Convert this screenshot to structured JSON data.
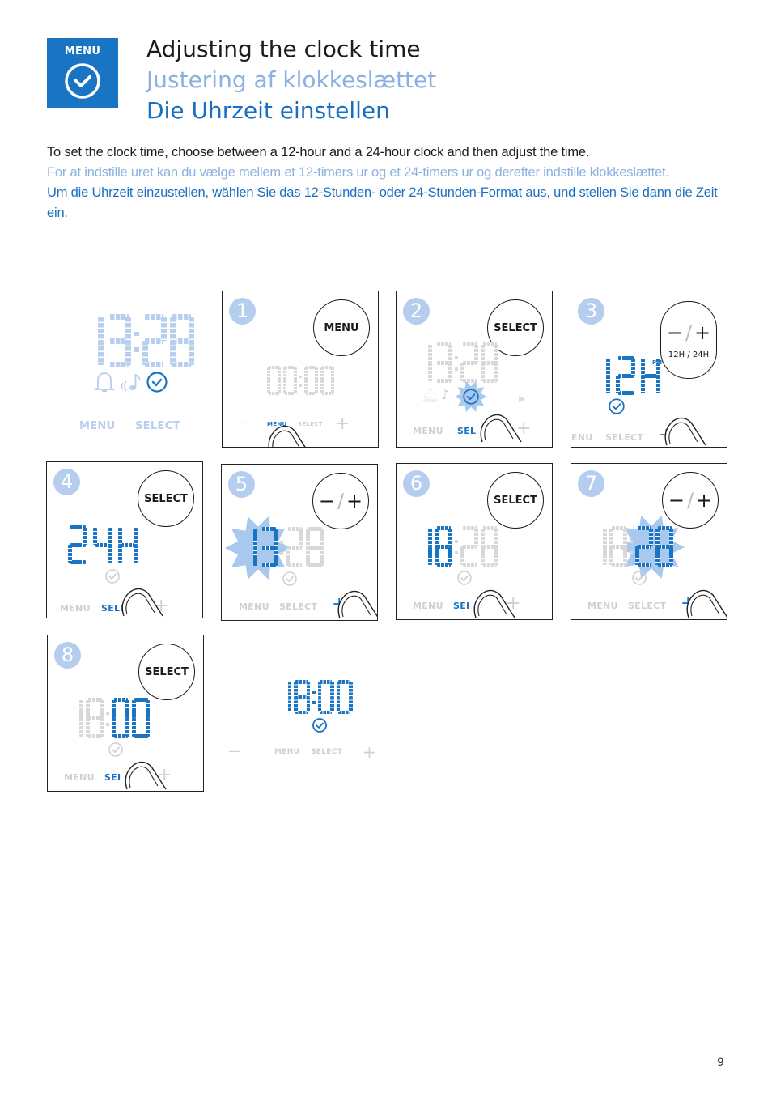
{
  "header": {
    "badge_label": "MENU",
    "badge_icon": "clock-check-icon",
    "title_en": "Adjusting the clock time",
    "title_da": "Justering af klokkeslættet",
    "title_de": "Die Uhrzeit einstellen"
  },
  "intro": {
    "en": "To set the clock time, choose between a 12-hour and a 24-hour clock and then adjust the time.",
    "da": "For at indstille uret kan du vælge mellem et 12-timers ur og et 24-timers ur og derefter indstille klokkeslættet.",
    "de": "Um die Uhrzeit einzustellen, wählen Sie das 12-Stunden- oder 24-Stunden-Format aus, und stellen Sie dann die Zeit ein."
  },
  "colors": {
    "brand_blue": "#1a74c4",
    "light_blue": "#b9cfee",
    "inactive_gray": "#d8d8d8"
  },
  "overview": {
    "display": "13:28",
    "icons": [
      "alarm-bell-icon",
      "music-note-icon",
      "clock-check-icon"
    ],
    "menu_label": "MENU",
    "select_label": "SELECT"
  },
  "steps": [
    {
      "number": "1",
      "callout": "MENU",
      "display": "00:00",
      "display_state": "inactive",
      "labels": {
        "minus": "—",
        "menu": "MENU",
        "select": "SELECT",
        "plus": "+"
      },
      "pressed": "menu"
    },
    {
      "number": "2",
      "callout": "SELECT",
      "display": "13:28",
      "display_state": "inactive",
      "labels": {
        "menu": "MENU",
        "select": "SEL",
        "plus": "+"
      },
      "pressed": "select",
      "highlight_icon": "clock-check-icon"
    },
    {
      "number": "3",
      "callout_sign": "− / +",
      "callout_sub": "12H / 24H",
      "display": "12H",
      "display_suffix": "PM",
      "display_state": "active",
      "labels": {
        "menu": "ENU",
        "select": "SELECT",
        "plus": "+"
      },
      "pressed": "plus"
    },
    {
      "number": "4",
      "callout": "SELECT",
      "display": "24H",
      "display_state": "active",
      "labels": {
        "menu": "MENU",
        "select": "SELE",
        "plus": "+"
      },
      "pressed": "select"
    },
    {
      "number": "5",
      "callout_sign": "− / +",
      "display": "13:28",
      "display_state": "hours-flashing",
      "labels": {
        "menu": "MENU",
        "select": "SELECT",
        "plus": "+"
      },
      "pressed": "plus"
    },
    {
      "number": "6",
      "callout": "SELECT",
      "display": "18:28",
      "display_state": "hours-set",
      "labels": {
        "menu": "MENU",
        "select": "SEI",
        "plus": "+"
      },
      "pressed": "select"
    },
    {
      "number": "7",
      "callout_sign": "− / +",
      "display": "18:28",
      "display_state": "minutes-flashing",
      "labels": {
        "menu": "MENU",
        "select": "SELECT",
        "plus": "+"
      },
      "pressed": "plus"
    },
    {
      "number": "8",
      "callout": "SELECT",
      "display": "18:00",
      "display_state": "minutes-set",
      "labels": {
        "menu": "MENU",
        "select": "SEI",
        "plus": "+"
      },
      "pressed": "select"
    }
  ],
  "final": {
    "display": "18:00",
    "labels": {
      "minus": "—",
      "menu": "MENU",
      "select": "SELECT",
      "plus": "+"
    }
  },
  "page_number": "9"
}
